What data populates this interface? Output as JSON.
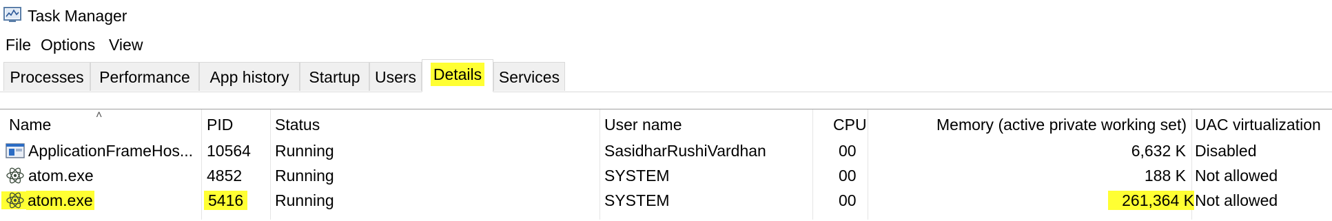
{
  "window": {
    "title": "Task Manager"
  },
  "menu": [
    "File",
    "Options",
    "View"
  ],
  "tabs": [
    "Processes",
    "Performance",
    "App history",
    "Startup",
    "Users",
    "Details",
    "Services"
  ],
  "active_tab": "Details",
  "columns": {
    "name": "Name",
    "pid": "PID",
    "status": "Status",
    "user": "User name",
    "cpu": "CPU",
    "memory": "Memory (active private working set)",
    "uac": "UAC virtualization"
  },
  "rows": [
    {
      "name": "ApplicationFrameHos...",
      "pid": "10564",
      "status": "Running",
      "user": "SasidharRushiVardhan",
      "cpu": "00",
      "memory": "6,632 K",
      "uac": "Disabled",
      "icon": "app-frame-icon",
      "highlighted": false
    },
    {
      "name": "atom.exe",
      "pid": "4852",
      "status": "Running",
      "user": "SYSTEM",
      "cpu": "00",
      "memory": "188 K",
      "uac": "Not allowed",
      "icon": "atom-icon",
      "highlighted": false
    },
    {
      "name": "atom.exe",
      "pid": "5416",
      "status": "Running",
      "user": "SYSTEM",
      "cpu": "00",
      "memory": "261,364 K",
      "uac": "Not allowed",
      "icon": "atom-icon",
      "highlighted": true
    }
  ],
  "colors": {
    "highlight": "#ffff33",
    "tab_bg": "#f0f0f0",
    "border": "#d9d9d9"
  }
}
